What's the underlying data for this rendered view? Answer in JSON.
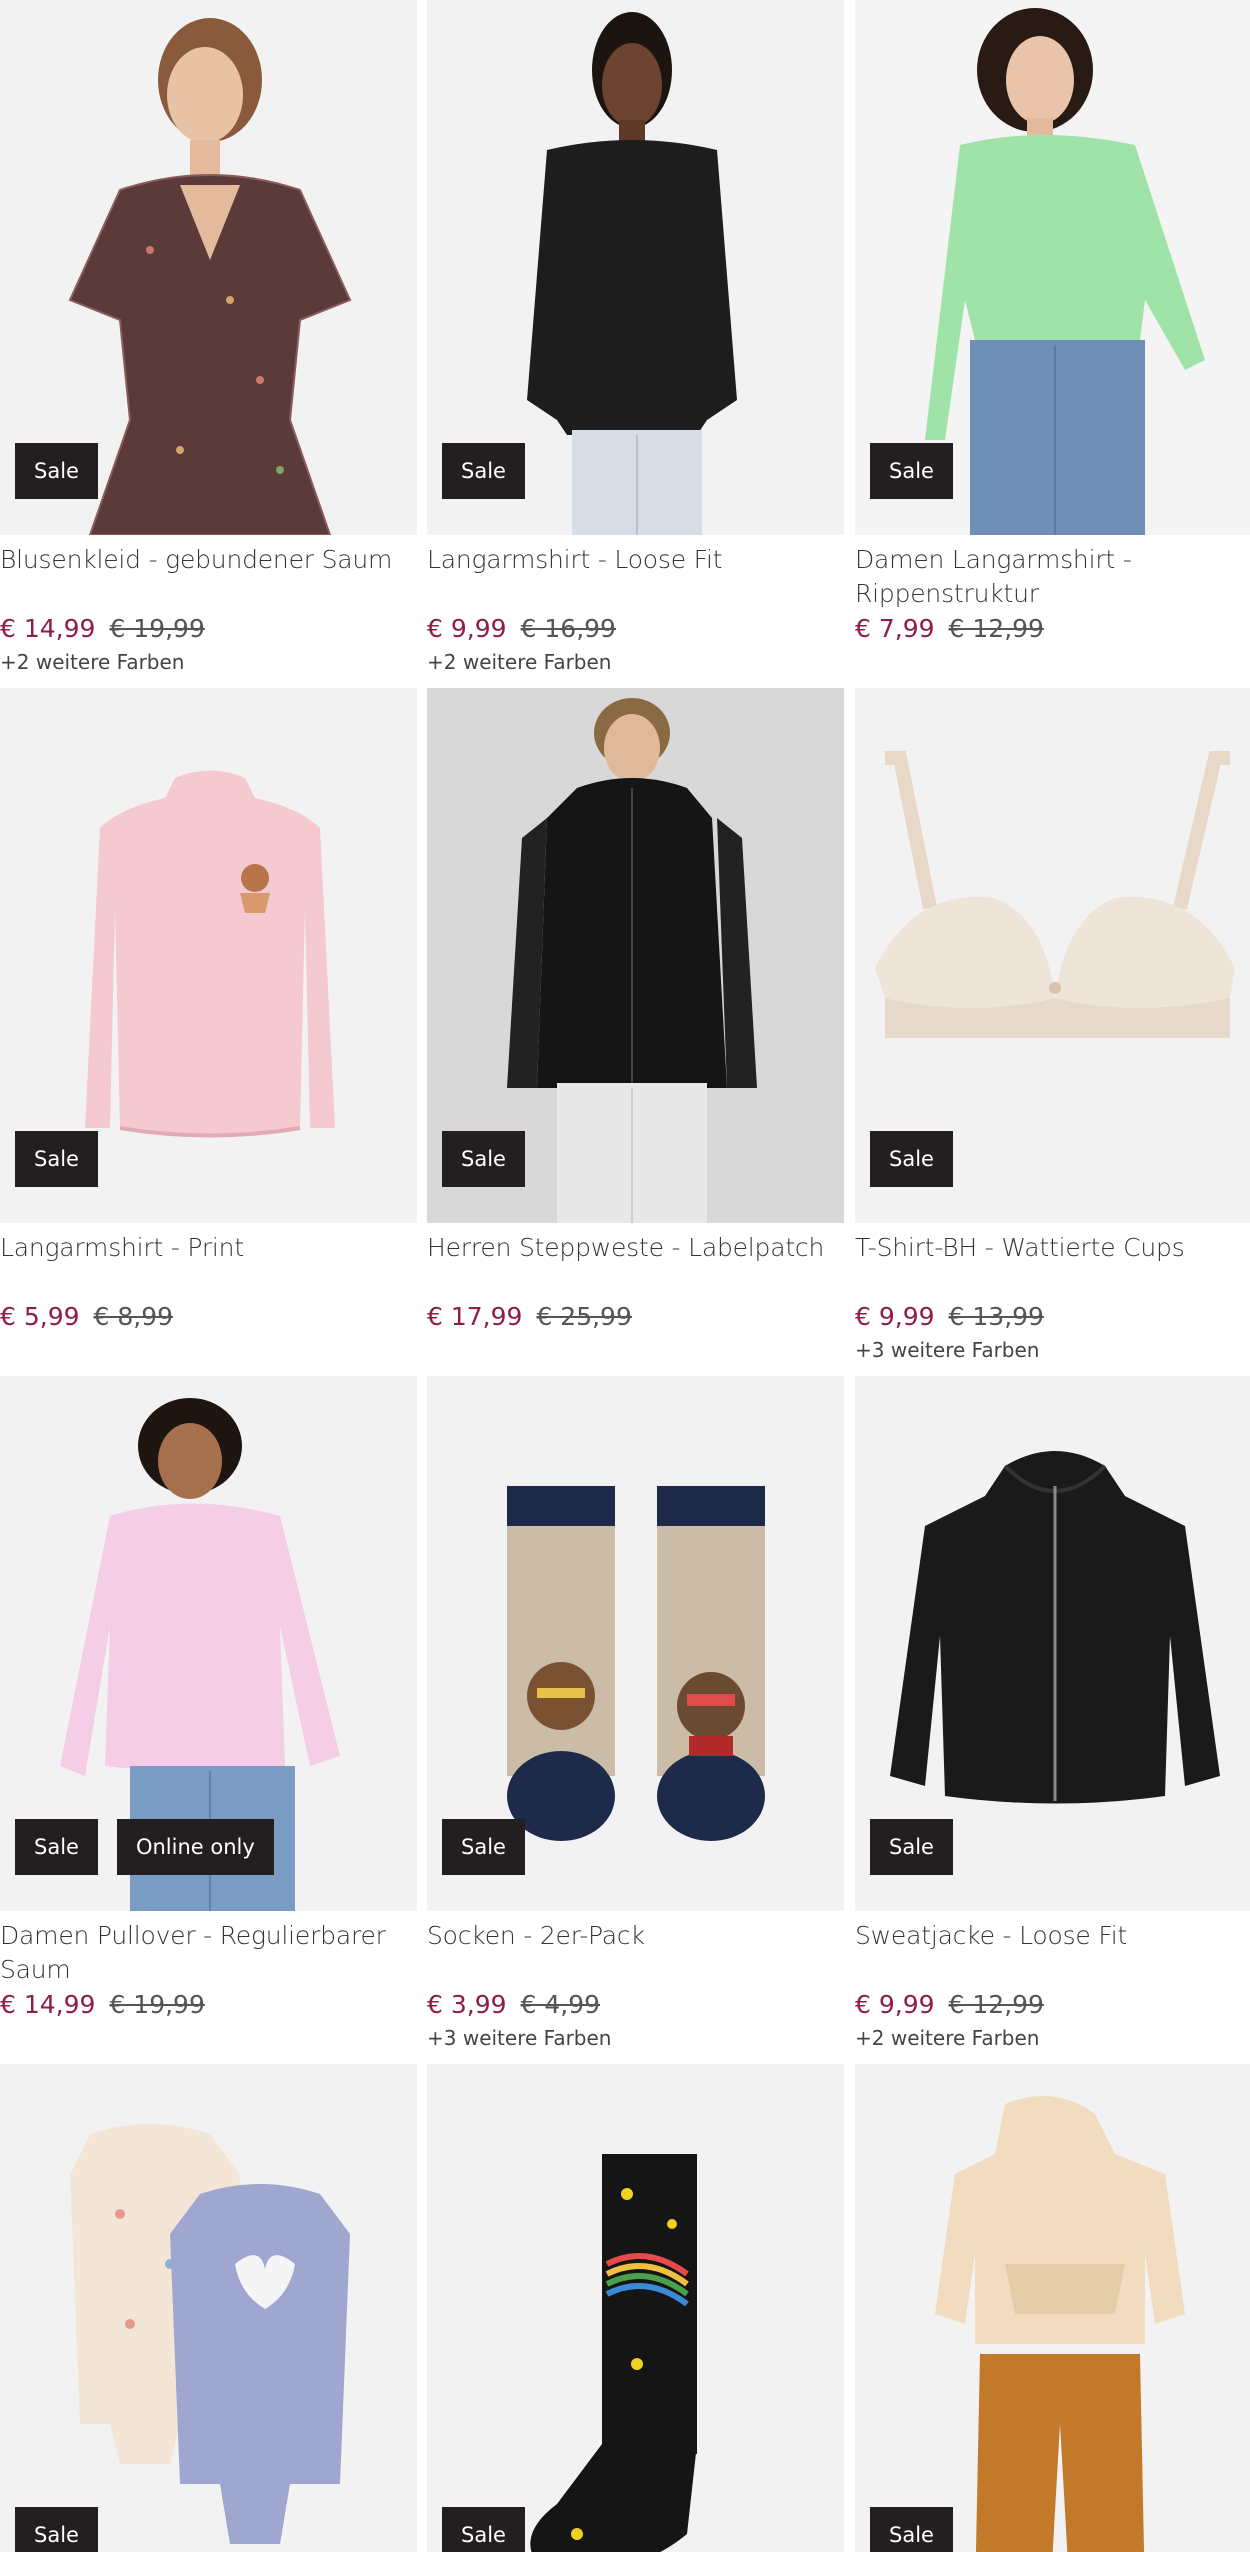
{
  "products": [
    {
      "title": "Blusenkleid - gebundener Saum",
      "price": "€ 14,99",
      "old_price": "€ 19,99",
      "colors": "+2 weitere Farben",
      "badges": [
        "Sale"
      ],
      "image": "floral-dress-woman"
    },
    {
      "title": "Langarmshirt - Loose Fit",
      "price": "€ 9,99",
      "old_price": "€ 16,99",
      "colors": "+2 weitere Farben",
      "badges": [
        "Sale"
      ],
      "image": "black-sweater-woman"
    },
    {
      "title": "Damen Langarmshirt - Rippenstruktur",
      "price": "€ 7,99",
      "old_price": "€ 12,99",
      "colors": "",
      "badges": [
        "Sale"
      ],
      "image": "mint-shirt-woman"
    },
    {
      "title": "Langarmshirt - Print",
      "price": "€ 5,99",
      "old_price": "€ 8,99",
      "colors": "",
      "badges": [
        "Sale"
      ],
      "image": "pink-kids-shirt"
    },
    {
      "title": "Herren Steppweste - Labelpatch",
      "price": "€ 17,99",
      "old_price": "€ 25,99",
      "colors": "",
      "badges": [
        "Sale"
      ],
      "image": "black-vest-man"
    },
    {
      "title": "T-Shirt-BH - Wattierte Cups",
      "price": "€ 9,99",
      "old_price": "€ 13,99",
      "colors": "+3 weitere Farben",
      "badges": [
        "Sale"
      ],
      "image": "beige-lace-bra"
    },
    {
      "title": "Damen Pullover - Regulierbarer Saum",
      "price": "€ 14,99",
      "old_price": "€ 19,99",
      "colors": "",
      "badges": [
        "Sale",
        "Online only"
      ],
      "image": "pink-pullover-woman"
    },
    {
      "title": "Socken - 2er-Pack",
      "price": "€ 3,99",
      "old_price": "€ 4,99",
      "colors": "+3 weitere Farben",
      "badges": [
        "Sale"
      ],
      "image": "animal-socks-pair"
    },
    {
      "title": "Sweatjacke - Loose Fit",
      "price": "€ 9,99",
      "old_price": "€ 12,99",
      "colors": "+2 weitere Farben",
      "badges": [
        "Sale"
      ],
      "image": "black-zip-hoodie"
    },
    {
      "title": "",
      "price": "",
      "old_price": "",
      "colors": "",
      "badges": [
        "Sale"
      ],
      "image": "baby-sleepsuits"
    },
    {
      "title": "",
      "price": "",
      "old_price": "",
      "colors": "",
      "badges": [
        "Sale"
      ],
      "image": "rainbow-star-sock"
    },
    {
      "title": "",
      "price": "",
      "old_price": "",
      "colors": "",
      "badges": [
        "Sale"
      ],
      "image": "kids-hoodie-pants-set"
    }
  ],
  "colors": {
    "price": "#8e1d4b",
    "badge_bg": "#231f20",
    "image_bg": "#f2f2f2"
  }
}
